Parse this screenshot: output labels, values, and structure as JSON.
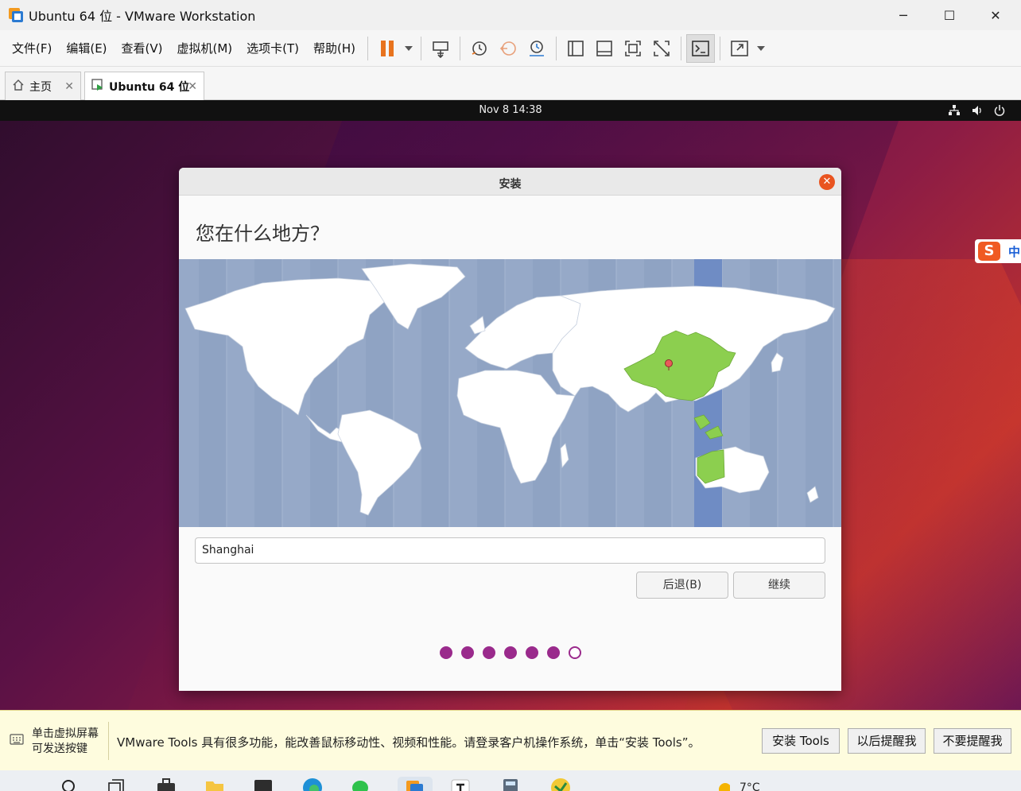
{
  "window": {
    "title": "Ubuntu 64 位 - VMware Workstation",
    "minimize": "─",
    "maximize": "☐",
    "close": "✕"
  },
  "menu": [
    "文件(F)",
    "编辑(E)",
    "查看(V)",
    "虚拟机(M)",
    "选项卡(T)",
    "帮助(H)"
  ],
  "tabs": [
    {
      "label": "主页"
    },
    {
      "label": "Ubuntu 64 位"
    }
  ],
  "tab_close": "✕",
  "ubuntu_topbar": {
    "clock": "Nov 8  14:38"
  },
  "installer": {
    "window_title": "安装",
    "close_glyph": "✕",
    "question": "您在什么地方？",
    "timezone_value": "Shanghai",
    "back_label": "后退(B)",
    "continue_label": "继续",
    "progress": {
      "total": 7,
      "current": 7
    }
  },
  "sogou": {
    "glyph": "S",
    "label": "中"
  },
  "tools_bar": {
    "hint_line1": "单击虚拟屏幕",
    "hint_line2": "可发送按键",
    "message": "VMware Tools 具有很多功能，能改善鼠标移动性、视频和性能。请登录客户机操作系统，单击“安装 Tools”。",
    "install_label": "安装 Tools",
    "later_label": "以后提醒我",
    "never_label": "不要提醒我"
  },
  "taskbar": {
    "weather_temp": "7°C"
  },
  "colors": {
    "ubuntu_orange": "#e95420",
    "progress_purple": "#9a2a8c",
    "map_ocean": "#96a9c8",
    "map_land": "#ffffff",
    "highlight_country": "#8ccf4f",
    "timezone_band": "#6f8cc4",
    "pause_orange": "#e8731e"
  },
  "icons": [
    "vmware-logo-icon",
    "pause-icon",
    "send-keys-icon",
    "snapshot-icon",
    "revert-icon",
    "snapshot-manager-icon",
    "sidebar-view-icon",
    "library-view-icon",
    "fullscreen-icon",
    "unity-icon",
    "console-icon",
    "stretch-icon",
    "home-icon",
    "vm-tab-icon",
    "network-icon",
    "volume-icon",
    "power-icon",
    "keyboard-icon",
    "location-pin-icon"
  ]
}
